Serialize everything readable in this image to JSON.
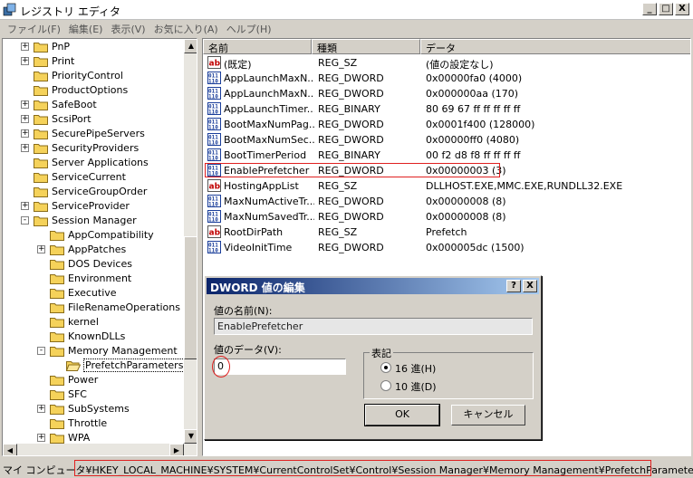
{
  "window": {
    "title": "レジストリ エディタ",
    "min": "_",
    "max": "□",
    "close": "X"
  },
  "menu": [
    "ファイル(F)",
    "編集(E)",
    "表示(V)",
    "お気に入り(A)",
    "ヘルプ(H)"
  ],
  "tree": [
    {
      "label": "PnP",
      "depth": 0,
      "expander": "+"
    },
    {
      "label": "Print",
      "depth": 0,
      "expander": "+"
    },
    {
      "label": "PriorityControl",
      "depth": 0,
      "expander": ""
    },
    {
      "label": "ProductOptions",
      "depth": 0,
      "expander": ""
    },
    {
      "label": "SafeBoot",
      "depth": 0,
      "expander": "+"
    },
    {
      "label": "ScsiPort",
      "depth": 0,
      "expander": "+"
    },
    {
      "label": "SecurePipeServers",
      "depth": 0,
      "expander": "+"
    },
    {
      "label": "SecurityProviders",
      "depth": 0,
      "expander": "+"
    },
    {
      "label": "Server Applications",
      "depth": 0,
      "expander": ""
    },
    {
      "label": "ServiceCurrent",
      "depth": 0,
      "expander": ""
    },
    {
      "label": "ServiceGroupOrder",
      "depth": 0,
      "expander": ""
    },
    {
      "label": "ServiceProvider",
      "depth": 0,
      "expander": "+"
    },
    {
      "label": "Session Manager",
      "depth": 0,
      "expander": "-"
    },
    {
      "label": "AppCompatibility",
      "depth": 1,
      "expander": ""
    },
    {
      "label": "AppPatches",
      "depth": 1,
      "expander": "+"
    },
    {
      "label": "DOS Devices",
      "depth": 1,
      "expander": ""
    },
    {
      "label": "Environment",
      "depth": 1,
      "expander": ""
    },
    {
      "label": "Executive",
      "depth": 1,
      "expander": ""
    },
    {
      "label": "FileRenameOperations",
      "depth": 1,
      "expander": ""
    },
    {
      "label": "kernel",
      "depth": 1,
      "expander": ""
    },
    {
      "label": "KnownDLLs",
      "depth": 1,
      "expander": ""
    },
    {
      "label": "Memory Management",
      "depth": 1,
      "expander": "-"
    },
    {
      "label": "PrefetchParameters",
      "depth": 2,
      "expander": "",
      "selected": true
    },
    {
      "label": "Power",
      "depth": 1,
      "expander": ""
    },
    {
      "label": "SFC",
      "depth": 1,
      "expander": ""
    },
    {
      "label": "SubSystems",
      "depth": 1,
      "expander": "+"
    },
    {
      "label": "Throttle",
      "depth": 1,
      "expander": ""
    },
    {
      "label": "WPA",
      "depth": 1,
      "expander": "+"
    }
  ],
  "list": {
    "headers": [
      "名前",
      "種類",
      "データ"
    ],
    "rows": [
      {
        "icon": "string",
        "name": "(既定)",
        "type": "REG_SZ",
        "data": "(値の設定なし)"
      },
      {
        "icon": "binary",
        "name": "AppLaunchMaxN...",
        "type": "REG_DWORD",
        "data": "0x00000fa0 (4000)"
      },
      {
        "icon": "binary",
        "name": "AppLaunchMaxN...",
        "type": "REG_DWORD",
        "data": "0x000000aa (170)"
      },
      {
        "icon": "binary",
        "name": "AppLaunchTimer...",
        "type": "REG_BINARY",
        "data": "80 69 67 ff ff ff ff ff"
      },
      {
        "icon": "binary",
        "name": "BootMaxNumPag...",
        "type": "REG_DWORD",
        "data": "0x0001f400 (128000)"
      },
      {
        "icon": "binary",
        "name": "BootMaxNumSec...",
        "type": "REG_DWORD",
        "data": "0x00000ff0 (4080)"
      },
      {
        "icon": "binary",
        "name": "BootTimerPeriod",
        "type": "REG_BINARY",
        "data": "00 f2 d8 f8 ff ff ff ff"
      },
      {
        "icon": "binary",
        "name": "EnablePrefetcher",
        "type": "REG_DWORD",
        "data": "0x00000003 (3)",
        "highlight": true
      },
      {
        "icon": "string",
        "name": "HostingAppList",
        "type": "REG_SZ",
        "data": "DLLHOST.EXE,MMC.EXE,RUNDLL32.EXE"
      },
      {
        "icon": "binary",
        "name": "MaxNumActiveTr...",
        "type": "REG_DWORD",
        "data": "0x00000008 (8)"
      },
      {
        "icon": "binary",
        "name": "MaxNumSavedTr...",
        "type": "REG_DWORD",
        "data": "0x00000008 (8)"
      },
      {
        "icon": "string",
        "name": "RootDirPath",
        "type": "REG_SZ",
        "data": "Prefetch"
      },
      {
        "icon": "binary",
        "name": "VideoInitTime",
        "type": "REG_DWORD",
        "data": "0x000005dc (1500)"
      }
    ]
  },
  "dialog": {
    "title": "DWORD 値の編集",
    "help": "?",
    "close": "X",
    "name_label": "値の名前(N):",
    "name_value": "EnablePrefetcher",
    "data_label": "値のデータ(V):",
    "data_value": "0",
    "base_label": "表記",
    "hex_label": "16 進(H)",
    "dec_label": "10 進(D)",
    "ok_label": "OK",
    "cancel_label": "キャンセル"
  },
  "statusbar": {
    "text": "マイ コンピュータ¥HKEY_LOCAL_MACHINE¥SYSTEM¥CurrentControlSet¥Control¥Session Manager¥Memory Management¥PrefetchParameters"
  },
  "colors": {
    "highlight": "#e02020",
    "dialog_title": "#0a246a",
    "folder": "#f5d25a"
  }
}
